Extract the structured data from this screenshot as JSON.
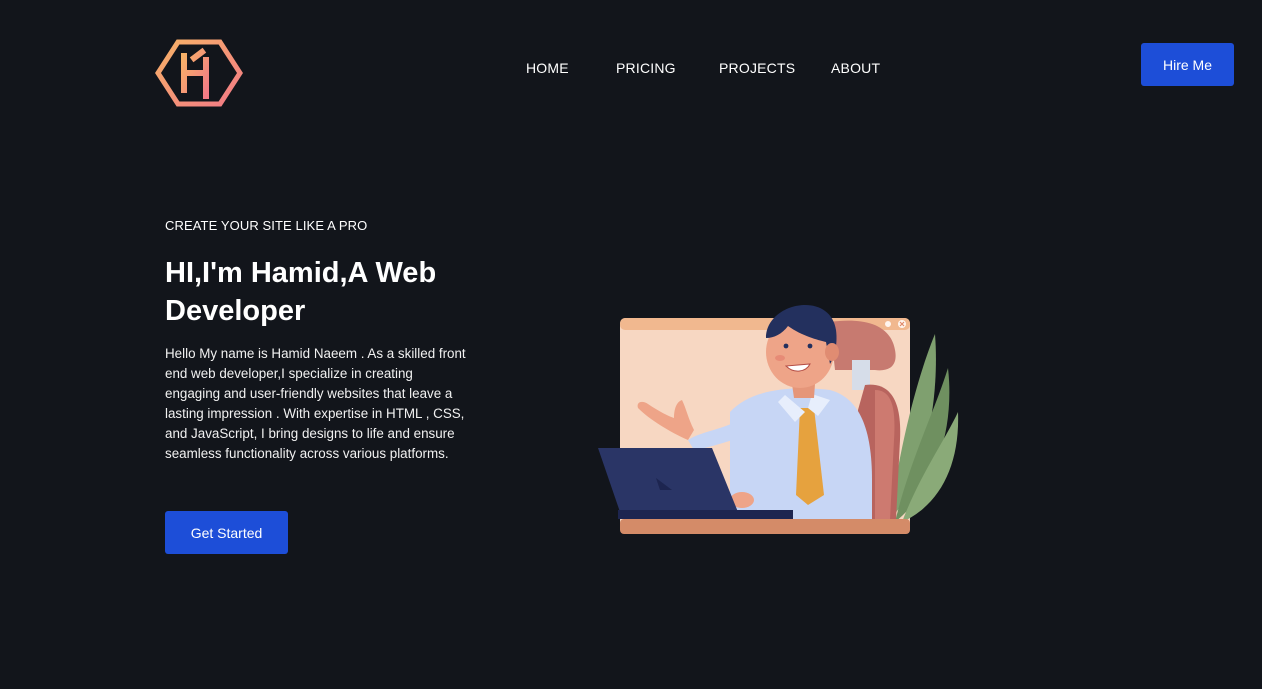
{
  "header": {
    "logo_icon": "hexagon-h-monogram-icon",
    "nav": [
      {
        "label": "HOME"
      },
      {
        "label": "PRICING"
      },
      {
        "label": "PROJECTS"
      },
      {
        "label": "ABOUT"
      }
    ],
    "hire_label": "Hire Me"
  },
  "hero": {
    "tagline": "CREATE YOUR SITE LIKE A PRO",
    "headline": "HI,I'm Hamid,A Web Developer",
    "intro": "Hello My name is Hamid Naeem . As a skilled front end web developer,I specialize in creating engaging and user-friendly websites that leave a lasting impression . With expertise in HTML , CSS, and JavaScript, I bring designs to life and ensure seamless functionality across various platforms.",
    "cta_label": "Get Started",
    "illustration_icon": "developer-at-laptop-illustration"
  },
  "colors": {
    "background": "#12151b",
    "accent": "#1d4ed8",
    "text": "#ffffff",
    "logo_gradient_start": "#f7b267",
    "logo_gradient_end": "#f27a86"
  }
}
